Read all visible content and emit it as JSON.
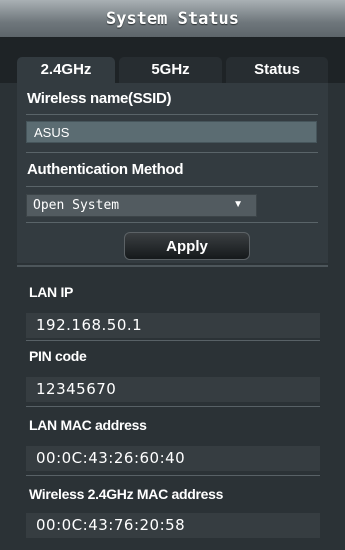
{
  "title": "System Status",
  "tabs": [
    {
      "label": "2.4GHz",
      "active": true
    },
    {
      "label": "5GHz",
      "active": false
    },
    {
      "label": "Status",
      "active": false
    }
  ],
  "wireless": {
    "ssid_label": "Wireless name(SSID)",
    "ssid_value": "ASUS",
    "auth_label": "Authentication Method",
    "auth_value": "Open System",
    "apply_label": "Apply"
  },
  "info": [
    {
      "label": "LAN IP",
      "value": "192.168.50.1"
    },
    {
      "label": "PIN code",
      "value": "12345670"
    },
    {
      "label": "LAN MAC address",
      "value": "00:0C:43:26:60:40"
    },
    {
      "label": "Wireless 2.4GHz MAC address",
      "value": "00:0C:43:76:20:58"
    }
  ]
}
